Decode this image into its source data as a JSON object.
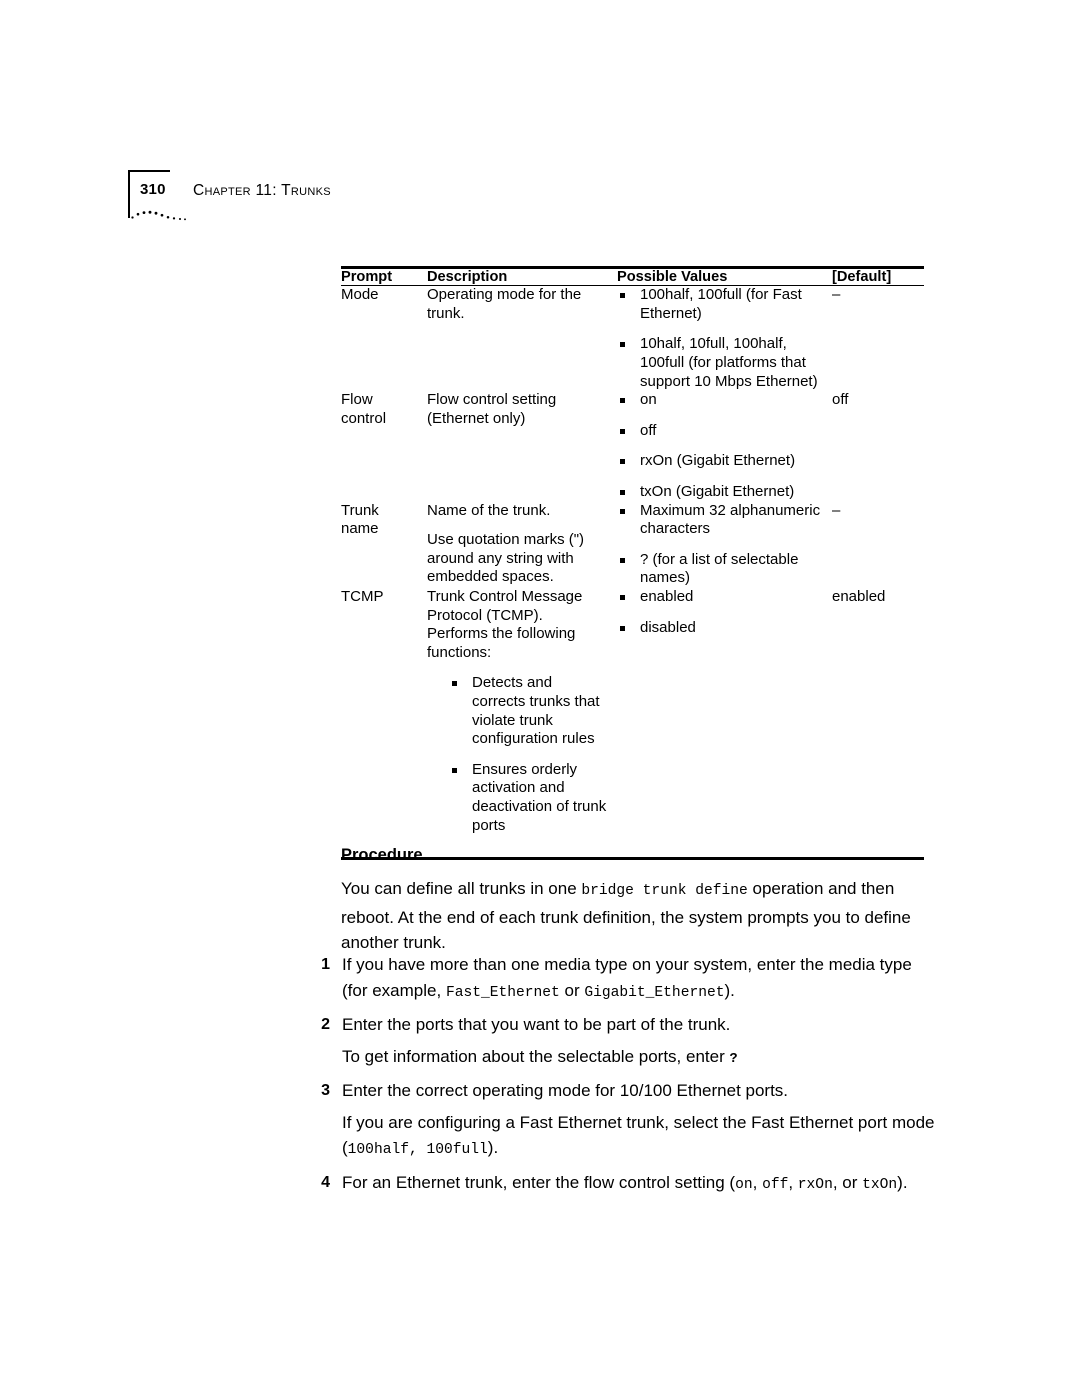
{
  "header": {
    "folio": "310",
    "chapter": "Chapter 11: Trunks"
  },
  "table": {
    "columns": [
      "Prompt",
      "Description",
      "Possible Values",
      "[Default]"
    ],
    "rows": [
      {
        "prompt": "Mode",
        "description": [
          "Operating mode for the trunk."
        ],
        "values": [
          "100half, 100full (for Fast Ethernet)",
          "10half, 10full, 100half, 100full (for platforms that support 10 Mbps Ethernet)"
        ],
        "default": "–"
      },
      {
        "prompt": "Flow control",
        "description": [
          "Flow control setting (Ethernet only)"
        ],
        "values": [
          "on",
          "off",
          "rxOn (Gigabit Ethernet)",
          "txOn (Gigabit Ethernet)"
        ],
        "default": "off"
      },
      {
        "prompt": "Trunk name",
        "description": [
          "Name of the trunk.",
          "Use quotation marks (\") around any string with embedded spaces."
        ],
        "values": [
          "Maximum 32 alphanumeric characters",
          "? (for a list of selectable names)"
        ],
        "default": "–"
      },
      {
        "prompt": "TCMP",
        "description": [
          "Trunk Control Message Protocol (TCMP). Performs the following functions:"
        ],
        "description_bullets": [
          "Detects and corrects trunks that violate trunk configuration rules",
          "Ensures orderly activation and deactivation of trunk ports"
        ],
        "values": [
          "enabled",
          "disabled"
        ],
        "default": "enabled"
      }
    ]
  },
  "procedure": {
    "heading": "Procedure",
    "intro_part1": "You can define all trunks in one ",
    "intro_code": "bridge trunk define",
    "intro_part2": " operation and then reboot. At the end of each trunk definition, the system prompts you to define another trunk.",
    "steps": [
      {
        "num": "1",
        "part1": "If you have more than one media type on your system, enter the media type (for example, ",
        "code1": "Fast_Ethernet",
        "part2": " or ",
        "code2": "Gigabit_Ethernet",
        "part3": ")."
      },
      {
        "num": "2",
        "part1": "Enter the ports that you want to be part of the trunk.",
        "sub_part1": "To get information about the selectable ports, enter ",
        "sub_code": "?"
      },
      {
        "num": "3",
        "part1": "Enter the correct operating mode for 10/100 Ethernet ports.",
        "sub_part1": "If you are configuring a Fast Ethernet trunk, select the Fast Ethernet port mode (",
        "sub_code": "100half, 100full",
        "sub_part2": ")."
      },
      {
        "num": "4",
        "part1": "For an Ethernet trunk, enter the flow control setting (",
        "code1": "on",
        "part2": ", ",
        "code2": "off",
        "part3": ", ",
        "code3": "rxOn",
        "part4": ", or ",
        "code4": "txOn",
        "part5": ")."
      }
    ]
  }
}
